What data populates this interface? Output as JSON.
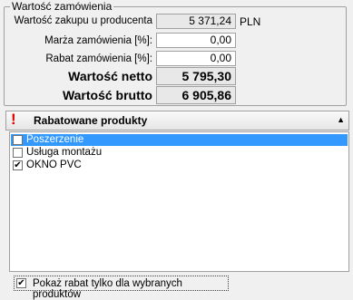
{
  "order_value": {
    "title": "Wartość zamówienia",
    "purchase_label": "Wartość zakupu u producenta",
    "purchase_value": "5 371,24",
    "currency": "PLN",
    "margin_label": "Marża zamówienia [%]:",
    "margin_value": "0,00",
    "discount_label": "Rabat zamówienia [%]:",
    "discount_value": "0,00",
    "net_label": "Wartość netto",
    "net_value": "5 795,30",
    "gross_label": "Wartość brutto",
    "gross_value": "6 905,86"
  },
  "discounted_products": {
    "icon": "!",
    "title": "Rabatowane produkty",
    "collapse_glyph": "▲",
    "items": [
      {
        "label": "Poszerzenie",
        "checked": false,
        "selected": true,
        "check_mark": ""
      },
      {
        "label": "Usługa montażu",
        "checked": false,
        "selected": false,
        "check_mark": ""
      },
      {
        "label": "OKNO PVC",
        "checked": true,
        "selected": false,
        "check_mark": "✔"
      }
    ]
  },
  "show_discount_only_selected": {
    "label": "Pokaż rabat tylko dla wybranych produktów",
    "checked": true,
    "check_mark": "✔"
  }
}
